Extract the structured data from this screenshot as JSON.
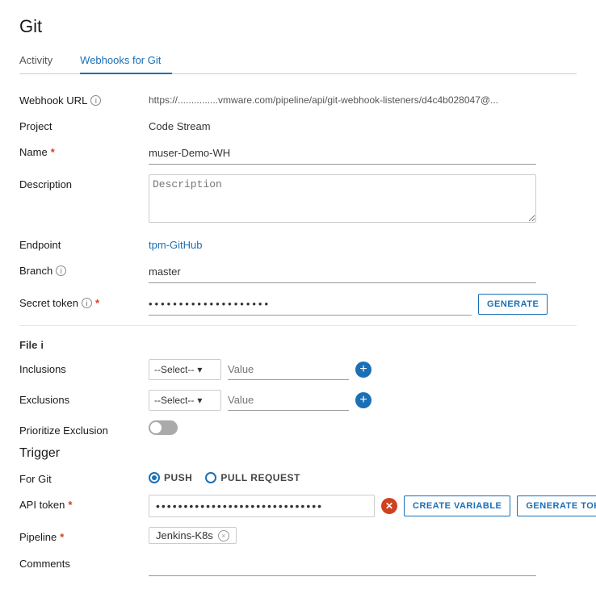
{
  "page": {
    "title": "Git",
    "tabs": [
      {
        "id": "activity",
        "label": "Activity",
        "active": false
      },
      {
        "id": "webhooks",
        "label": "Webhooks for Git",
        "active": true
      }
    ]
  },
  "form": {
    "webhookUrl": {
      "label": "Webhook URL",
      "value": "https://...............vmware.com/pipeline/api/git-webhook-listeners/d4c4b028047@..."
    },
    "project": {
      "label": "Project",
      "value": "Code Stream"
    },
    "name": {
      "label": "Name",
      "required": true,
      "value": "muser-Demo-WH",
      "placeholder": ""
    },
    "description": {
      "label": "Description",
      "placeholder": "Description",
      "value": ""
    },
    "endpoint": {
      "label": "Endpoint",
      "value": "tpm-GitHub"
    },
    "branch": {
      "label": "Branch",
      "value": "master",
      "placeholder": ""
    },
    "secretToken": {
      "label": "Secret token",
      "required": true,
      "value": "••••••••••••••••••••••",
      "generateLabel": "GENERATE"
    },
    "file": {
      "sectionLabel": "File",
      "inclusions": {
        "label": "Inclusions",
        "selectPlaceholder": "--Select--",
        "valuePlaceholder": "Value"
      },
      "exclusions": {
        "label": "Exclusions",
        "selectPlaceholder": "--Select--",
        "valuePlaceholder": "Value"
      },
      "prioritizeExclusion": {
        "label": "Prioritize Exclusion",
        "enabled": false
      }
    },
    "trigger": {
      "sectionLabel": "Trigger",
      "forGit": {
        "label": "For Git",
        "options": [
          {
            "id": "push",
            "label": "PUSH",
            "selected": true
          },
          {
            "id": "pullRequest",
            "label": "PULL REQUEST",
            "selected": false
          }
        ]
      },
      "apiToken": {
        "label": "API token",
        "required": true,
        "value": "••••••••••••••••••••••••••••••",
        "createVariableLabel": "CREATE VARIABLE",
        "generateTokenLabel": "GENERATE TOKEN"
      },
      "pipeline": {
        "label": "Pipeline",
        "required": true,
        "value": "Jenkins-K8s"
      },
      "comments": {
        "label": "Comments",
        "value": "",
        "placeholder": ""
      }
    }
  },
  "icons": {
    "info": "i",
    "plus": "+",
    "close": "×",
    "chevronDown": "▾",
    "clearX": "✕"
  }
}
